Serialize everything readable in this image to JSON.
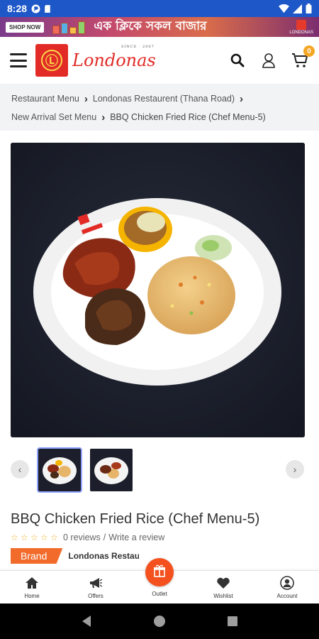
{
  "status_bar": {
    "time": "8:28"
  },
  "banner": {
    "shop_now": "SHOP NOW",
    "tagline": "এক ক্লিকে সকল বাজার",
    "brand": "LONDONAS"
  },
  "header": {
    "logo_text": "Londonas",
    "since": "SINCE · 2007",
    "cart_count": "0"
  },
  "breadcrumb": {
    "items": [
      "Restaurant Menu",
      "Londonas Restaurent (Thana Road)",
      "New Arrival Set Menu",
      "BBQ Chicken Fried Rice (Chef Menu-5)"
    ]
  },
  "product": {
    "title": "BBQ Chicken Fried Rice (Chef Menu-5)",
    "rating": 0,
    "reviews": "0 reviews",
    "write_review": "Write a review",
    "brand_label": "Brand",
    "brand_name": "Londonas Restaurent"
  },
  "bottom_nav": {
    "items": [
      {
        "label": "Home",
        "icon": "home-icon"
      },
      {
        "label": "Offers",
        "icon": "megaphone-icon"
      },
      {
        "label": "Outlet",
        "icon": "gift-icon"
      },
      {
        "label": "Wishlist",
        "icon": "heart-icon"
      },
      {
        "label": "Account",
        "icon": "account-icon"
      }
    ]
  },
  "colors": {
    "status_bar": "#1e57c8",
    "brand_red": "#e22b26",
    "accent_orange": "#f26b2b",
    "cart_badge": "#f5a623"
  }
}
